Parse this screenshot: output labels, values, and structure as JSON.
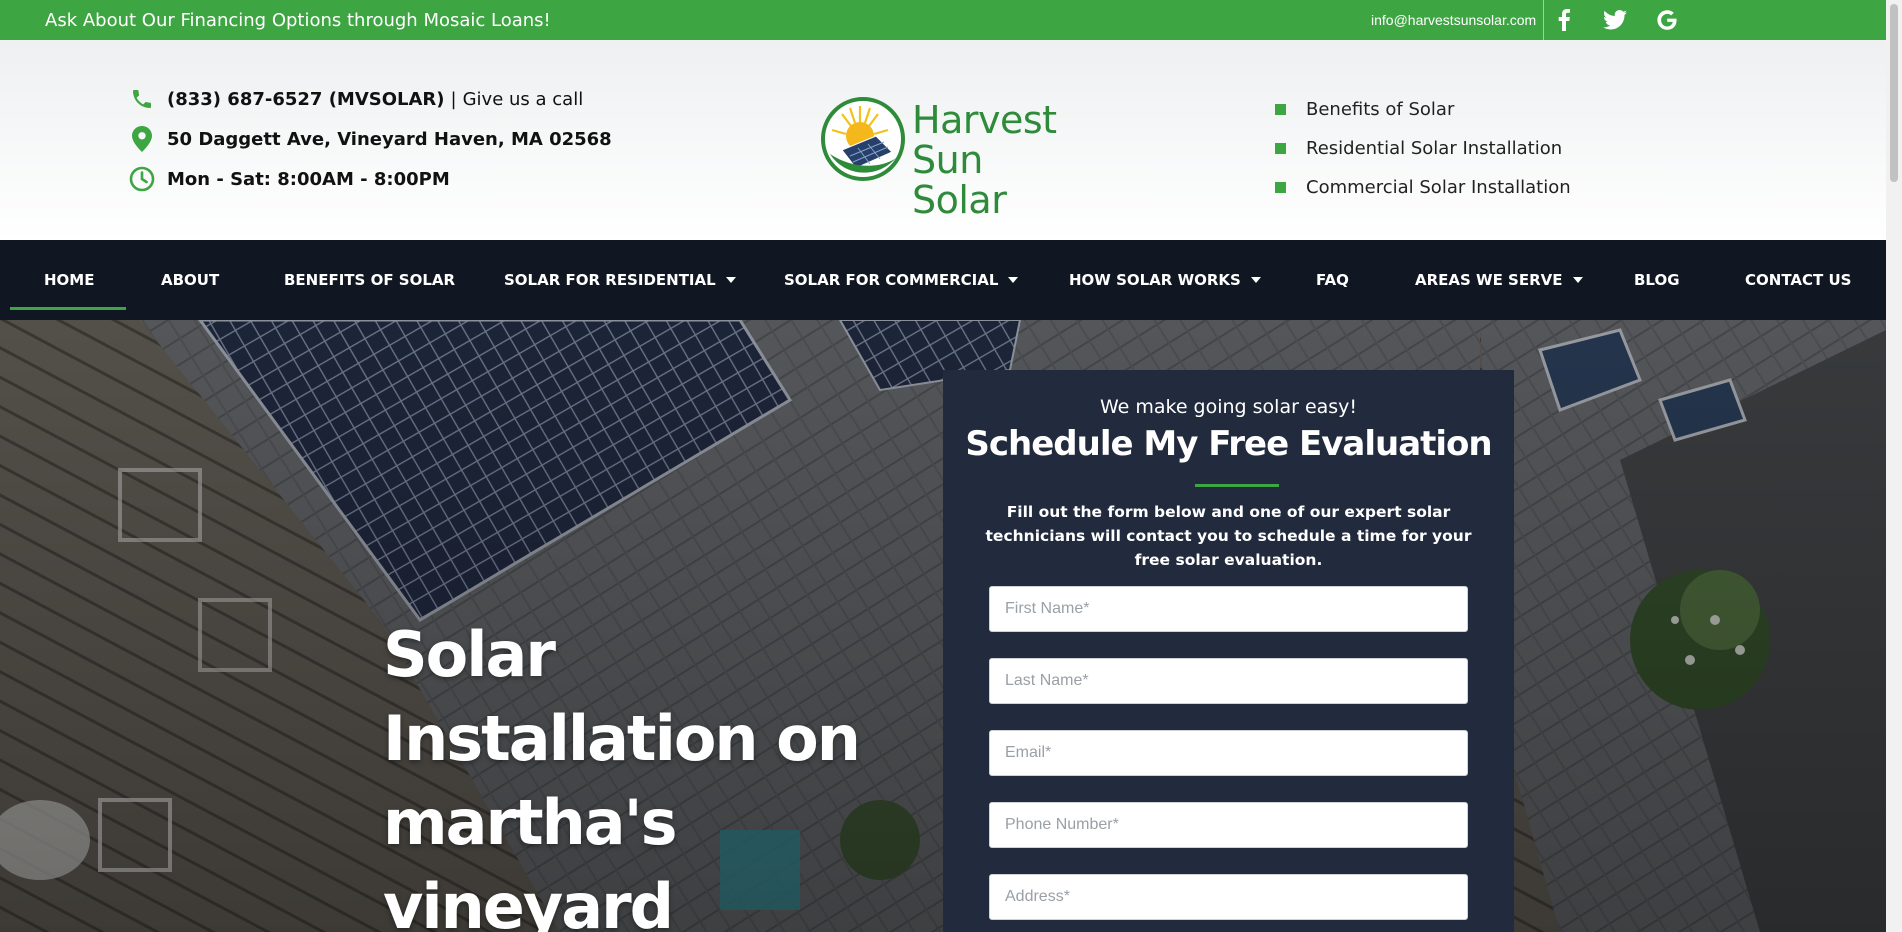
{
  "topbar": {
    "promo": "Ask About Our Financing Options through Mosaic Loans!",
    "email": "info@harvestsunsolar.com",
    "social": [
      "facebook-icon",
      "twitter-icon",
      "google-icon"
    ]
  },
  "header": {
    "phone": "(833) 687-6527 (MVSOLAR)",
    "phone_sep": "|",
    "phone_sub": "Give us a call",
    "address": "50 Daggett Ave, Vineyard Haven, MA 02568",
    "hours": "Mon - Sat: 8:00AM - 8:00PM",
    "logo_line1": "Harvest",
    "logo_line2": "Sun Solar",
    "links": [
      "Benefits of Solar",
      "Residential Solar Installation",
      "Commercial Solar Installation"
    ]
  },
  "nav": {
    "items": [
      {
        "label": "HOME"
      },
      {
        "label": "ABOUT"
      },
      {
        "label": "BENEFITS OF SOLAR"
      },
      {
        "label": "SOLAR FOR RESIDENTIAL"
      },
      {
        "label": "SOLAR FOR COMMERCIAL"
      },
      {
        "label": "HOW SOLAR WORKS"
      },
      {
        "label": "FAQ"
      },
      {
        "label": "AREAS WE SERVE"
      },
      {
        "label": "BLOG"
      },
      {
        "label": "CONTACT US"
      }
    ],
    "active": "HOME"
  },
  "hero": {
    "title_line1": "Solar Installation on",
    "title_line2": "martha's vineyard"
  },
  "form": {
    "tagline": "We make going solar easy!",
    "heading": "Schedule My Free Evaluation",
    "description": "Fill out the form below and one of our expert solar technicians will contact you to schedule a time for your free solar evaluation.",
    "fields": {
      "first_name": {
        "placeholder": "First Name*",
        "value": ""
      },
      "last_name": {
        "placeholder": "Last Name*",
        "value": ""
      },
      "email": {
        "placeholder": "Email*",
        "value": ""
      },
      "phone": {
        "placeholder": "Phone Number*",
        "value": ""
      },
      "address": {
        "placeholder": "Address*",
        "value": ""
      }
    }
  },
  "colors": {
    "brand_green": "#3ea543",
    "nav_bg": "#111722",
    "panel_bg": "#222b3d"
  }
}
